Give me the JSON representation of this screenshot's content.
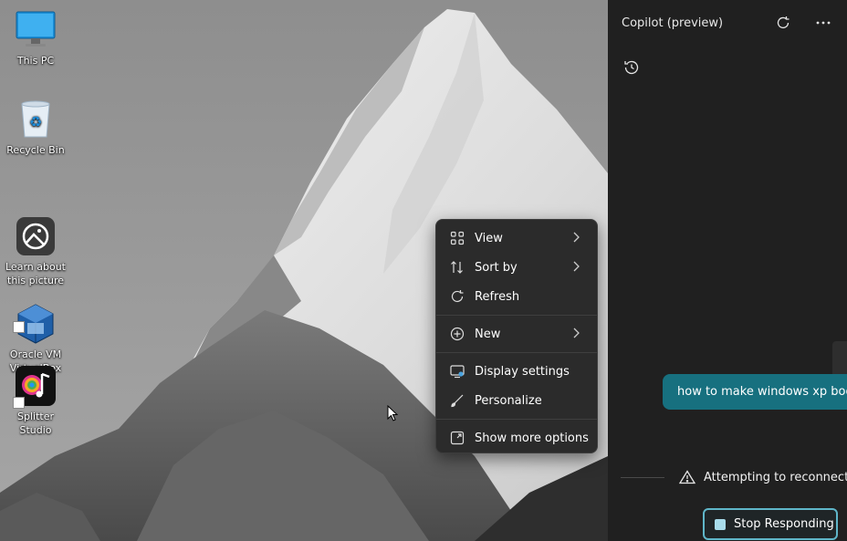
{
  "desktop": {
    "icons": [
      {
        "label": "This PC",
        "icon": "monitor-icon"
      },
      {
        "label": "Recycle Bin",
        "icon": "recycle-bin-icon"
      },
      {
        "label": "Learn about\nthis picture",
        "icon": "camera-info-icon"
      },
      {
        "label": "Oracle VM\nVirtualBox",
        "icon": "virtualbox-icon"
      },
      {
        "label": "Splitter Studio",
        "icon": "splitter-studio-icon"
      }
    ]
  },
  "context_menu": {
    "groups": [
      [
        {
          "label": "View",
          "icon": "grid-icon",
          "submenu": true
        },
        {
          "label": "Sort by",
          "icon": "sort-icon",
          "submenu": true
        },
        {
          "label": "Refresh",
          "icon": "refresh-icon",
          "submenu": false
        }
      ],
      [
        {
          "label": "New",
          "icon": "plus-circle-icon",
          "submenu": true
        }
      ],
      [
        {
          "label": "Display settings",
          "icon": "display-icon",
          "submenu": false
        },
        {
          "label": "Personalize",
          "icon": "brush-icon",
          "submenu": false
        }
      ],
      [
        {
          "label": "Show more options",
          "icon": "expand-icon",
          "submenu": false
        }
      ]
    ]
  },
  "copilot": {
    "title": "Copilot (preview)",
    "user_message": "how to make windows xp boot",
    "status": "Attempting to reconnect...",
    "stop_button": "Stop Responding",
    "colors": {
      "panel_bg": "#202020",
      "bubble_bg": "#17707f",
      "stop_border": "#5fb6c9"
    }
  }
}
